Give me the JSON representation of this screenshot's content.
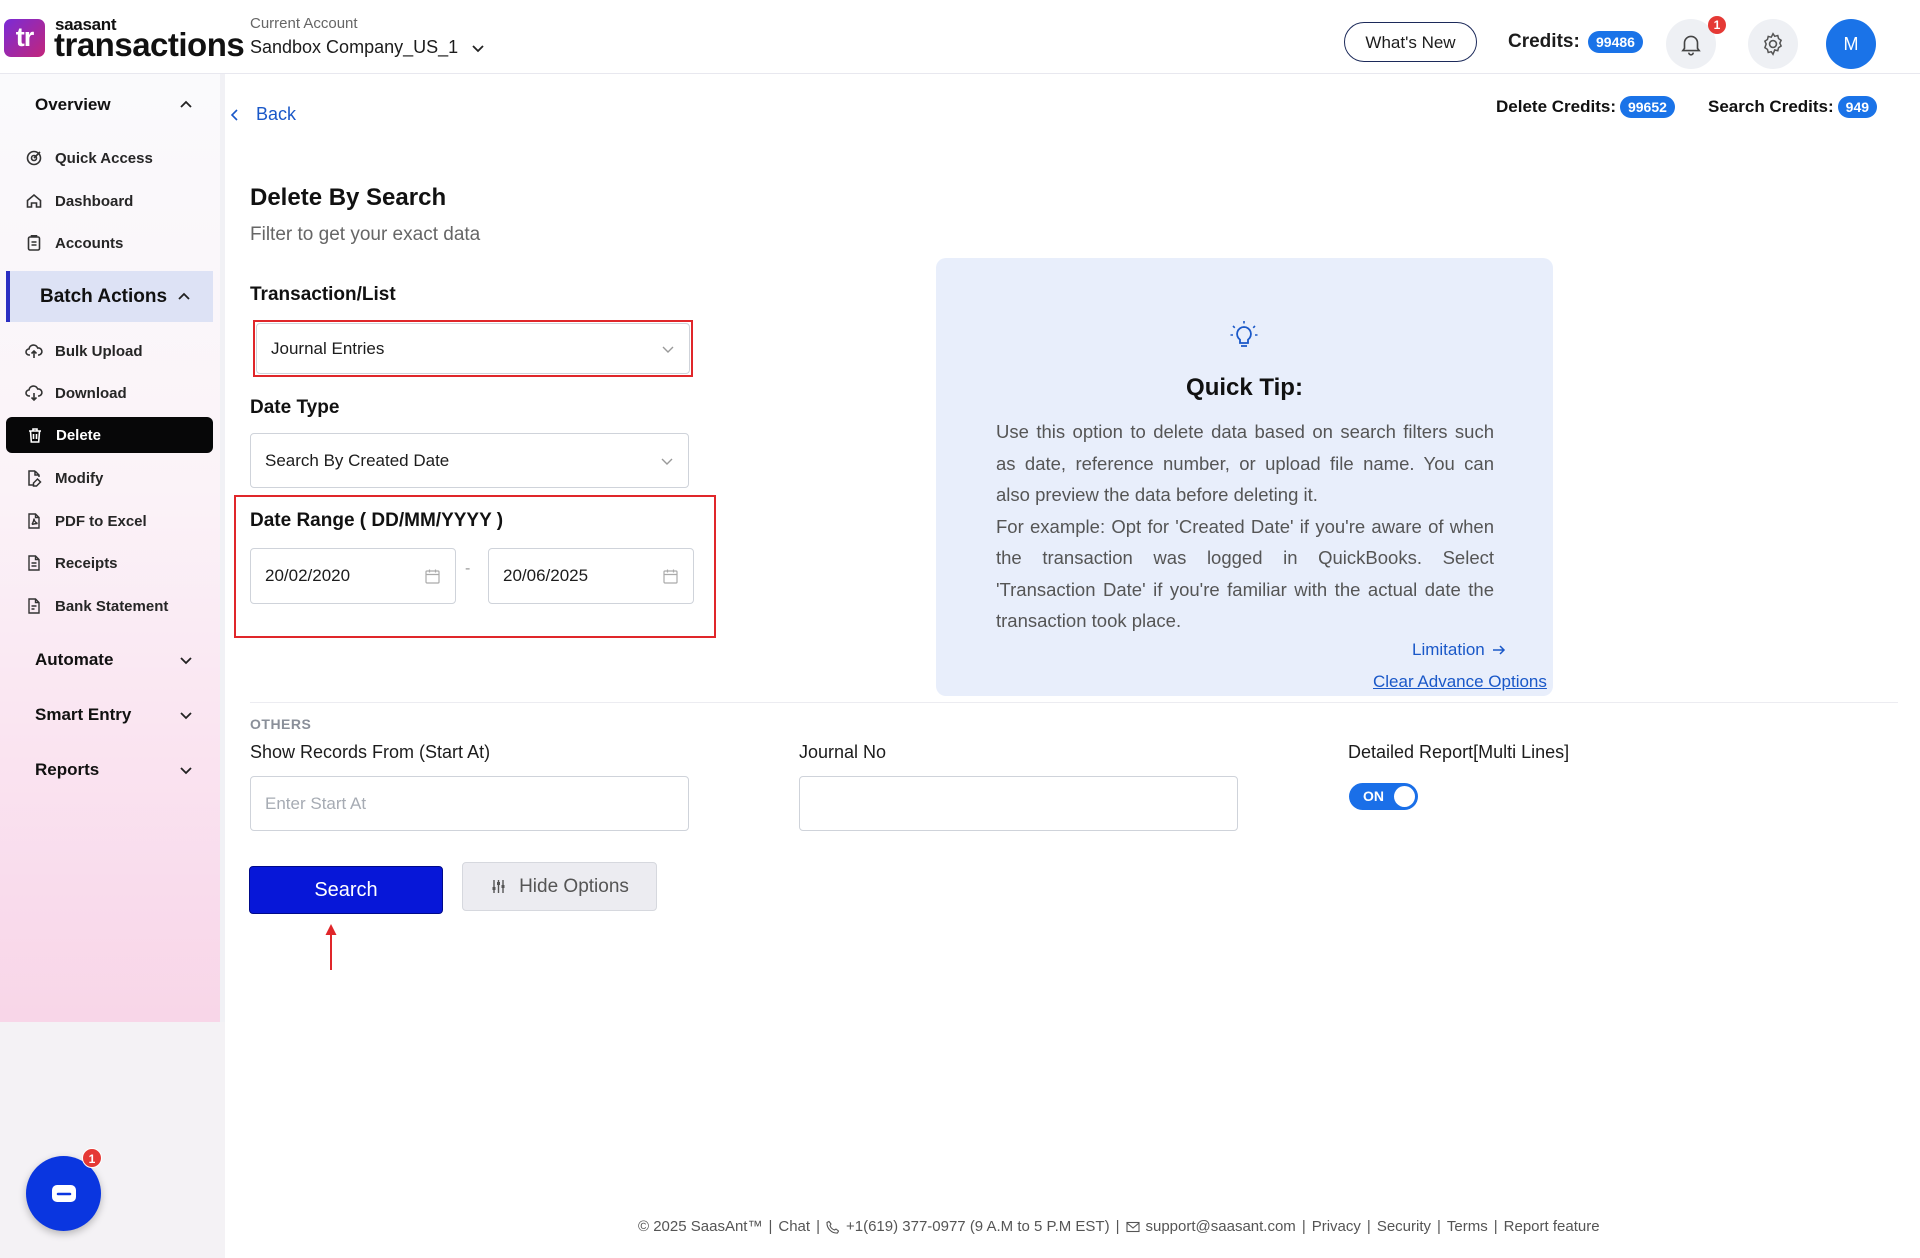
{
  "brand": {
    "logo": "tr",
    "small": "saasant",
    "big": "transactions"
  },
  "account": {
    "label": "Current Account",
    "name": "Sandbox Company_US_1"
  },
  "header": {
    "whats_new": "What's New",
    "credits_label": "Credits:",
    "credits_value": "99486",
    "notif_count": "1",
    "avatar_initial": "M"
  },
  "sidebar": {
    "overview": "Overview",
    "overview_items": [
      "Quick Access",
      "Dashboard",
      "Accounts"
    ],
    "batch_actions": "Batch Actions",
    "batch_items": [
      "Bulk Upload",
      "Download",
      "Delete",
      "Modify",
      "PDF to Excel",
      "Receipts",
      "Bank Statement"
    ],
    "automate": "Automate",
    "smart_entry": "Smart Entry",
    "reports": "Reports",
    "chat_badge": "1"
  },
  "subheader": {
    "back": "Back",
    "delete_credits_label": "Delete Credits:",
    "delete_credits_value": "99652",
    "search_credits_label": "Search Credits:",
    "search_credits_value": "949"
  },
  "form": {
    "title": "Delete By Search",
    "subtitle": "Filter to get your exact data",
    "transaction_label": "Transaction/List",
    "transaction_value": "Journal Entries",
    "date_type_label": "Date Type",
    "date_type_value": "Search By Created Date",
    "date_range_label": "Date Range ( DD/MM/YYYY )",
    "date_from": "20/02/2020",
    "date_dash": "-",
    "date_to": "20/06/2025",
    "others_label": "OTHERS",
    "start_at_label": "Show Records From (Start At)",
    "start_at_placeholder": "Enter Start At",
    "journal_no_label": "Journal No",
    "journal_no_value": "",
    "detailed_label": "Detailed Report[Multi Lines]",
    "toggle_state": "ON",
    "search_button": "Search",
    "hide_button": "Hide Options"
  },
  "tip": {
    "title": "Quick Tip:",
    "lines": [
      "Use this option to delete data based on search filters such as date, reference number, or upload file name. You can also preview the data before deleting it.",
      "For example: Opt for 'Created Date' if you're aware of when the transaction was logged in QuickBooks. Select 'Transaction Date' if you're familiar with the actual date the transaction took place."
    ],
    "limitation": "Limitation",
    "clear_advance": "Clear Advance Options"
  },
  "footer": {
    "copyright": "© 2025 SaasAnt™",
    "chat": "Chat",
    "phone": "+1(619) 377-0977 (9 A.M to 5 P.M EST)",
    "email": "support@saasant.com",
    "privacy": "Privacy",
    "security": "Security",
    "terms": "Terms",
    "report": "Report feature"
  },
  "colors": {
    "accent": "#1a73e8",
    "search_button": "#0717d8",
    "highlight_box": "#e0262a"
  }
}
